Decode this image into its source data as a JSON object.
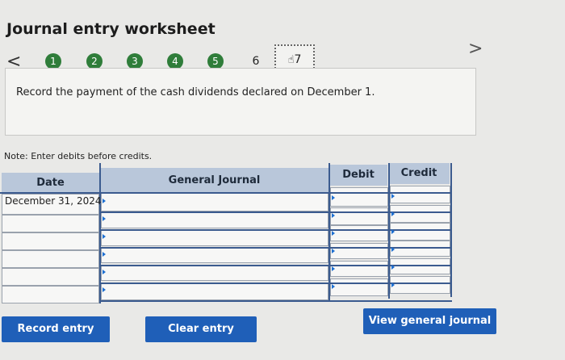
{
  "title": "Journal entry worksheet",
  "nav": {
    "prev": "<",
    "next": ">"
  },
  "steps": [
    "1",
    "2",
    "3",
    "4",
    "5",
    "6",
    "7"
  ],
  "current_step": "7",
  "prompt": "Record the payment of the cash dividends declared on December 1.",
  "note": "Note: Enter debits before credits.",
  "table": {
    "headers": {
      "date": "Date",
      "journal": "General Journal",
      "debit": "Debit",
      "credit": "Credit"
    },
    "rows": [
      {
        "date": "December 31, 2024",
        "journal": "",
        "debit": "",
        "credit": ""
      },
      {
        "date": "",
        "journal": "",
        "debit": "",
        "credit": ""
      },
      {
        "date": "",
        "journal": "",
        "debit": "",
        "credit": ""
      },
      {
        "date": "",
        "journal": "",
        "debit": "",
        "credit": ""
      },
      {
        "date": "",
        "journal": "",
        "debit": "",
        "credit": ""
      },
      {
        "date": "",
        "journal": "",
        "debit": "",
        "credit": ""
      }
    ]
  },
  "buttons": {
    "record": "Record entry",
    "clear": "Clear entry",
    "view": "View general journal"
  },
  "colors": {
    "accent": "#1f5fb8",
    "step_done": "#2f7d3a",
    "header_bg": "#b9c7da"
  },
  "icons": {
    "current_step": "hand-pointer-icon"
  }
}
